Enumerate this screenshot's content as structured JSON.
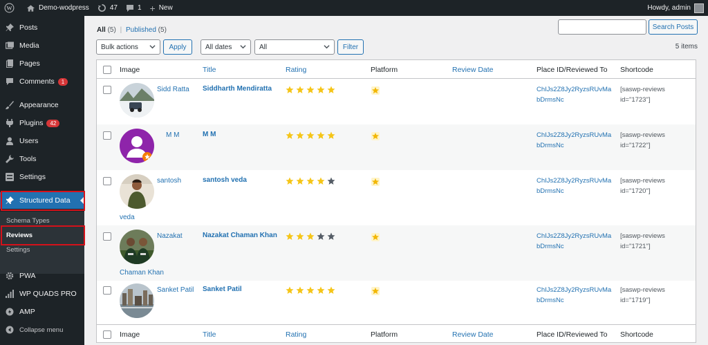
{
  "adminbar": {
    "site_name": "Demo-wodpress",
    "updates_count": "47",
    "comments_count": "1",
    "new_label": "New",
    "howdy": "Howdy, admin"
  },
  "sidebar": {
    "items": [
      {
        "label": "Posts",
        "icon": "pin-icon"
      },
      {
        "label": "Media",
        "icon": "media-icon"
      },
      {
        "label": "Pages",
        "icon": "pages-icon"
      },
      {
        "label": "Comments",
        "icon": "comment-icon",
        "badge": "1"
      },
      {
        "label": "Appearance",
        "icon": "brush-icon"
      },
      {
        "label": "Plugins",
        "icon": "plug-icon",
        "badge": "42"
      },
      {
        "label": "Users",
        "icon": "user-icon"
      },
      {
        "label": "Tools",
        "icon": "wrench-icon"
      },
      {
        "label": "Settings",
        "icon": "settings-icon"
      },
      {
        "label": "Structured Data",
        "icon": "pin-icon"
      },
      {
        "label": "PWA",
        "icon": "gear-icon"
      },
      {
        "label": "WP QUADS PRO",
        "icon": "bars-icon"
      },
      {
        "label": "AMP",
        "icon": "amp-icon"
      },
      {
        "label": "Collapse menu",
        "icon": "collapse-icon"
      }
    ],
    "submenu": [
      "Schema Types",
      "Reviews",
      "Settings"
    ]
  },
  "filters": {
    "all_label": "All",
    "all_count": "(5)",
    "separator": "|",
    "published_label": "Published",
    "published_count": "(5)",
    "bulk_actions": "Bulk actions",
    "apply": "Apply",
    "all_dates": "All dates",
    "all": "All",
    "filter": "Filter",
    "search_button": "Search Posts",
    "items_count": "5 items"
  },
  "table": {
    "columns": [
      "Image",
      "Title",
      "Rating",
      "Platform",
      "Review Date",
      "Place ID/Reviewed To",
      "Shortcode"
    ],
    "rows": [
      {
        "author": "Sidd Ratta",
        "title": "Siddharth Mendiratta",
        "rating": 5,
        "place_id": "ChIJs2Z8Jy2RyzsRUvMabDrmsNc",
        "shortcode": "[saswp-reviews id=\"1723\"]"
      },
      {
        "author": "M M",
        "title": "M M",
        "rating": 5,
        "place_id": "ChIJs2Z8Jy2RyzsRUvMabDrmsNc",
        "shortcode": "[saswp-reviews id=\"1722\"]"
      },
      {
        "author": "santosh",
        "author2": "veda",
        "title": "santosh veda",
        "rating": 4,
        "place_id": "ChIJs2Z8Jy2RyzsRUvMabDrmsNc",
        "shortcode": "[saswp-reviews id=\"1720\"]"
      },
      {
        "author": "Nazakat",
        "author2": "Chaman Khan",
        "title": "Nazakat Chaman Khan",
        "rating": 3,
        "place_id": "ChIJs2Z8Jy2RyzsRUvMabDrmsNc",
        "shortcode": "[saswp-reviews id=\"1721\"]"
      },
      {
        "author": "Sanket Patil",
        "title": "Sanket Patil",
        "rating": 5,
        "place_id": "ChIJs2Z8Jy2RyzsRUvMabDrmsNc",
        "shortcode": "[saswp-reviews id=\"1719\"]"
      }
    ]
  },
  "colors": {
    "adminbar_bg": "#1d2327",
    "accent": "#2271b1",
    "star_filled": "#f5c518",
    "star_empty": "#555d66",
    "highlight_box": "#d6111a"
  }
}
